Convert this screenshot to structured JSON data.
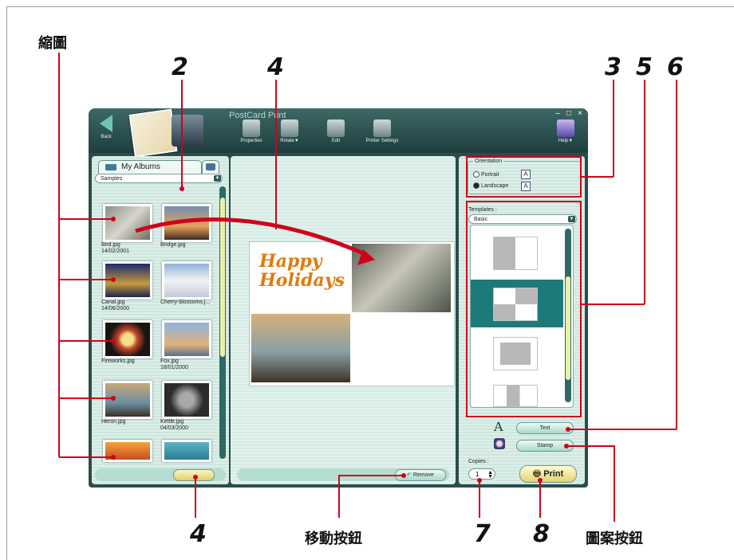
{
  "callouts": {
    "thumbnails": "縮圖",
    "n2": "2",
    "n4_top": "4",
    "n3": "3",
    "n5": "5",
    "n6": "6",
    "n4_bottom": "4",
    "move_button": "移動按鈕",
    "n7": "7",
    "n8": "8",
    "stamp_button": "圖案按鈕"
  },
  "window": {
    "title": "PostCard Print",
    "controls": [
      "–",
      "□",
      "×"
    ],
    "back_label": "Back",
    "toolbar": [
      {
        "label": "Properties",
        "icon": "properties-icon"
      },
      {
        "label": "Rotate▼",
        "icon": "rotate-icon"
      },
      {
        "label": "Edit",
        "icon": "edit-icon"
      },
      {
        "label": "Printer Settings",
        "icon": "printer-settings-icon"
      }
    ],
    "help_label": "Help▼"
  },
  "left_panel": {
    "tab_my_albums": "My Albums",
    "album_select": "Samples",
    "thumbnails": [
      {
        "name": "Bird.jpg",
        "date": "14/02/2001"
      },
      {
        "name": "Bridge.jpg",
        "date": ""
      },
      {
        "name": "Canal.jpg",
        "date": "14/06/2000"
      },
      {
        "name": "Cherry-blossoms.j...",
        "date": ""
      },
      {
        "name": "Fireworks.jpg",
        "date": ""
      },
      {
        "name": "Fox.jpg",
        "date": "18/01/2000"
      },
      {
        "name": "Heron.jpg",
        "date": ""
      },
      {
        "name": "Kettle.jpg",
        "date": "04/03/2000"
      }
    ]
  },
  "middle_panel": {
    "remove_label": "Remove",
    "card_text": "Happy Holidays"
  },
  "right_panel": {
    "orientation_title": "Orientation",
    "portrait_label": "Portrait",
    "landscape_label": "Landscape",
    "selected_orientation": "Landscape",
    "templates_label": "Templates :",
    "templates_select": "Basic",
    "text_button": "Text",
    "stamp_button": "Stamp",
    "copies_label": "Copies :",
    "copies_value": "1",
    "print_button": "Print"
  },
  "colors": {
    "callout_red": "#d0021b",
    "window_teal": "#2a4d4c",
    "selected_template": "#1e7a78"
  }
}
